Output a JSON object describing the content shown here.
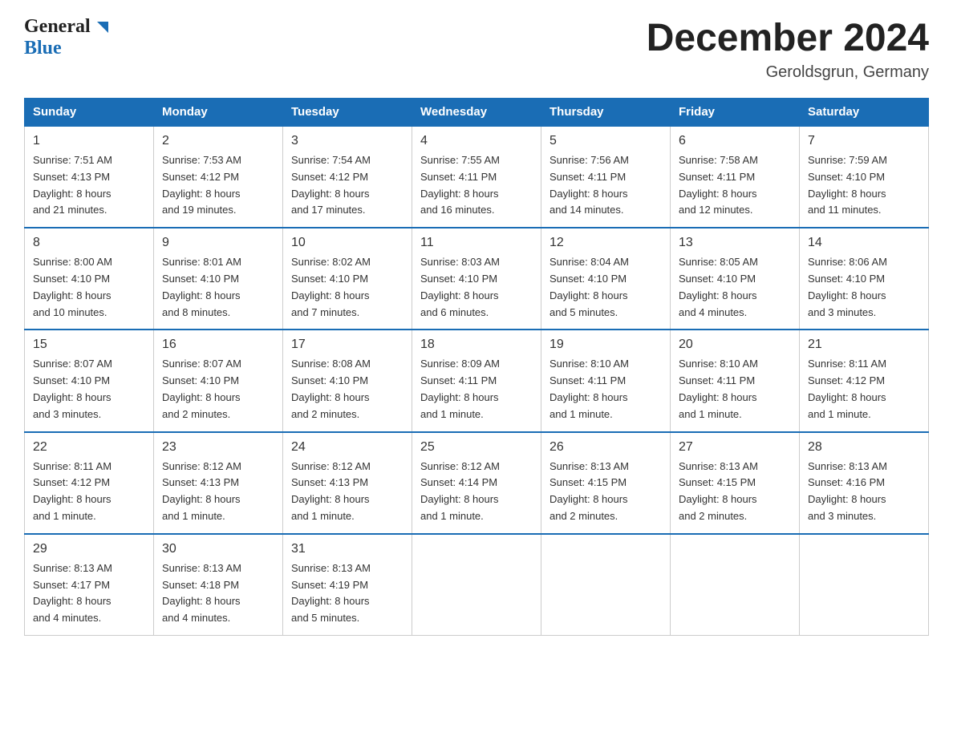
{
  "header": {
    "logo_general": "General",
    "logo_blue": "Blue",
    "month_title": "December 2024",
    "subtitle": "Geroldsgrun, Germany"
  },
  "days_of_week": [
    "Sunday",
    "Monday",
    "Tuesday",
    "Wednesday",
    "Thursday",
    "Friday",
    "Saturday"
  ],
  "weeks": [
    [
      {
        "day": "1",
        "sunrise": "7:51 AM",
        "sunset": "4:13 PM",
        "daylight": "8 hours and 21 minutes."
      },
      {
        "day": "2",
        "sunrise": "7:53 AM",
        "sunset": "4:12 PM",
        "daylight": "8 hours and 19 minutes."
      },
      {
        "day": "3",
        "sunrise": "7:54 AM",
        "sunset": "4:12 PM",
        "daylight": "8 hours and 17 minutes."
      },
      {
        "day": "4",
        "sunrise": "7:55 AM",
        "sunset": "4:11 PM",
        "daylight": "8 hours and 16 minutes."
      },
      {
        "day": "5",
        "sunrise": "7:56 AM",
        "sunset": "4:11 PM",
        "daylight": "8 hours and 14 minutes."
      },
      {
        "day": "6",
        "sunrise": "7:58 AM",
        "sunset": "4:11 PM",
        "daylight": "8 hours and 12 minutes."
      },
      {
        "day": "7",
        "sunrise": "7:59 AM",
        "sunset": "4:10 PM",
        "daylight": "8 hours and 11 minutes."
      }
    ],
    [
      {
        "day": "8",
        "sunrise": "8:00 AM",
        "sunset": "4:10 PM",
        "daylight": "8 hours and 10 minutes."
      },
      {
        "day": "9",
        "sunrise": "8:01 AM",
        "sunset": "4:10 PM",
        "daylight": "8 hours and 8 minutes."
      },
      {
        "day": "10",
        "sunrise": "8:02 AM",
        "sunset": "4:10 PM",
        "daylight": "8 hours and 7 minutes."
      },
      {
        "day": "11",
        "sunrise": "8:03 AM",
        "sunset": "4:10 PM",
        "daylight": "8 hours and 6 minutes."
      },
      {
        "day": "12",
        "sunrise": "8:04 AM",
        "sunset": "4:10 PM",
        "daylight": "8 hours and 5 minutes."
      },
      {
        "day": "13",
        "sunrise": "8:05 AM",
        "sunset": "4:10 PM",
        "daylight": "8 hours and 4 minutes."
      },
      {
        "day": "14",
        "sunrise": "8:06 AM",
        "sunset": "4:10 PM",
        "daylight": "8 hours and 3 minutes."
      }
    ],
    [
      {
        "day": "15",
        "sunrise": "8:07 AM",
        "sunset": "4:10 PM",
        "daylight": "8 hours and 3 minutes."
      },
      {
        "day": "16",
        "sunrise": "8:07 AM",
        "sunset": "4:10 PM",
        "daylight": "8 hours and 2 minutes."
      },
      {
        "day": "17",
        "sunrise": "8:08 AM",
        "sunset": "4:10 PM",
        "daylight": "8 hours and 2 minutes."
      },
      {
        "day": "18",
        "sunrise": "8:09 AM",
        "sunset": "4:11 PM",
        "daylight": "8 hours and 1 minute."
      },
      {
        "day": "19",
        "sunrise": "8:10 AM",
        "sunset": "4:11 PM",
        "daylight": "8 hours and 1 minute."
      },
      {
        "day": "20",
        "sunrise": "8:10 AM",
        "sunset": "4:11 PM",
        "daylight": "8 hours and 1 minute."
      },
      {
        "day": "21",
        "sunrise": "8:11 AM",
        "sunset": "4:12 PM",
        "daylight": "8 hours and 1 minute."
      }
    ],
    [
      {
        "day": "22",
        "sunrise": "8:11 AM",
        "sunset": "4:12 PM",
        "daylight": "8 hours and 1 minute."
      },
      {
        "day": "23",
        "sunrise": "8:12 AM",
        "sunset": "4:13 PM",
        "daylight": "8 hours and 1 minute."
      },
      {
        "day": "24",
        "sunrise": "8:12 AM",
        "sunset": "4:13 PM",
        "daylight": "8 hours and 1 minute."
      },
      {
        "day": "25",
        "sunrise": "8:12 AM",
        "sunset": "4:14 PM",
        "daylight": "8 hours and 1 minute."
      },
      {
        "day": "26",
        "sunrise": "8:13 AM",
        "sunset": "4:15 PM",
        "daylight": "8 hours and 2 minutes."
      },
      {
        "day": "27",
        "sunrise": "8:13 AM",
        "sunset": "4:15 PM",
        "daylight": "8 hours and 2 minutes."
      },
      {
        "day": "28",
        "sunrise": "8:13 AM",
        "sunset": "4:16 PM",
        "daylight": "8 hours and 3 minutes."
      }
    ],
    [
      {
        "day": "29",
        "sunrise": "8:13 AM",
        "sunset": "4:17 PM",
        "daylight": "8 hours and 4 minutes."
      },
      {
        "day": "30",
        "sunrise": "8:13 AM",
        "sunset": "4:18 PM",
        "daylight": "8 hours and 4 minutes."
      },
      {
        "day": "31",
        "sunrise": "8:13 AM",
        "sunset": "4:19 PM",
        "daylight": "8 hours and 5 minutes."
      },
      null,
      null,
      null,
      null
    ]
  ],
  "labels": {
    "sunrise": "Sunrise:",
    "sunset": "Sunset:",
    "daylight": "Daylight:"
  }
}
